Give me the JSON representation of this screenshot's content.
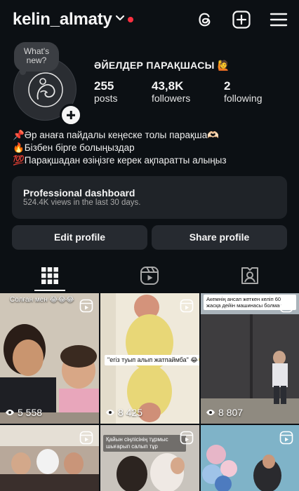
{
  "header": {
    "username": "kelin_almaty"
  },
  "profile": {
    "note_bubble": "What's new?",
    "display_name": "ӘЙЕЛДЕР ПАРАҚШАСЫ 🙋",
    "stats": [
      {
        "value": "255",
        "label": "posts"
      },
      {
        "value": "43,8K",
        "label": "followers"
      },
      {
        "value": "2",
        "label": "following"
      }
    ],
    "bio": [
      "📌Әр анаға пайдалы кеңеске толы парақша🫶🏻",
      "🔥Бізбен бірге болыңыздар",
      "💯Парақшадан өзіңізге керек ақпаратты алыңыз"
    ]
  },
  "dashboard": {
    "title": "Professional dashboard",
    "subtitle": "524.4K views in the last 30 days."
  },
  "buttons": {
    "edit": "Edit profile",
    "share": "Share profile"
  },
  "grid": [
    {
      "views": "5 558",
      "caption": "Солған мен 😂😂😂"
    },
    {
      "views": "8 425",
      "caption": "\"егіз туып алып жатпаймба\" 😂👏"
    },
    {
      "views": "8 807",
      "caption": "Акемнің ансап жеткен келіп 60 жасқа дейін машинасы болмағ"
    },
    {
      "views": "",
      "caption": ""
    },
    {
      "views": "",
      "caption": "Қайын сіңлісінің тұрмыс шығарып салып тұр"
    },
    {
      "views": "",
      "caption": ""
    }
  ],
  "colors": {
    "background": "#0c1014",
    "card": "#1f2328",
    "button": "#262a30",
    "notification_dot": "#ff3040"
  }
}
